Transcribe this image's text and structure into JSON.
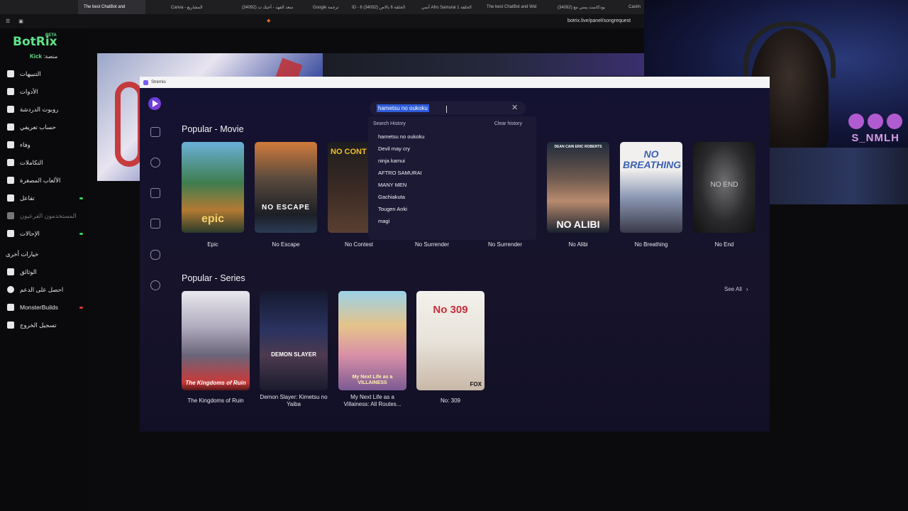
{
  "browser": {
    "tabs": [
      "The best ChatBot and",
      "Canva - المشاريع",
      "سعد الفهد - أحيك ت (34092)",
      "Google ترجمة",
      "ID - 6 الحلقة 6 بالاص (34092)",
      "أنمي Afro Samurai الحلقة 1",
      "The best ChatBot and Wid",
      "بودكاست يمني مع (34092)",
      "Castin"
    ],
    "url": "botrix.live/panel/songrequest"
  },
  "botrix": {
    "logo": "BotRix",
    "beta": "BETA",
    "platform_label": "منصة:",
    "platform_value": "Kick",
    "nav": [
      {
        "label": "التنبيهات",
        "icon": "alert-icon"
      },
      {
        "label": "الأدوات",
        "icon": "tools-icon"
      },
      {
        "label": "روبوت الدردشة",
        "icon": "bot-icon"
      },
      {
        "label": "حساب تعريفي",
        "icon": "profile-icon"
      },
      {
        "label": "وفاء",
        "icon": "trophy-icon"
      },
      {
        "label": "التكاملات",
        "icon": "integrations-icon"
      },
      {
        "label": "الألعاب المصغرة",
        "icon": "minigames-icon"
      },
      {
        "label": "تفاعل",
        "icon": "music-icon"
      },
      {
        "label": "المستخدمون الفرعيون",
        "icon": "subusers-icon"
      },
      {
        "label": "الإحالات",
        "icon": "referrals-icon"
      }
    ],
    "other_section": "خيارات أخرى",
    "other_nav": [
      {
        "label": "الوثائق",
        "icon": "docs-icon"
      },
      {
        "label": "احصل على الدعم",
        "icon": "support-icon"
      },
      {
        "label": "MonsterBuilds",
        "icon": "monster-icon"
      },
      {
        "label": "تسجيل الخروج",
        "icon": "logout-icon"
      }
    ]
  },
  "webcam": {
    "handle": "S_NMLH"
  },
  "stremio": {
    "window_title": "Stremio",
    "search": {
      "value": "hametsu no oukoku"
    },
    "history": {
      "header": "Search History",
      "clear": "Clear history",
      "items": [
        "hametsu no oukoku",
        "Devil may cry",
        "ninja kamui",
        "AFTRO SAMURAI",
        "MANY MEN",
        "Gachiakuta",
        "Tougen Anki",
        "magi"
      ]
    },
    "movies": {
      "title": "Popular - Movie",
      "items": [
        "Epic",
        "No Escape",
        "No Contest",
        "No Surrender",
        "No Surrender",
        "No Alibi",
        "No Breathing",
        "No End"
      ],
      "poster_text": {
        "epic": "epic",
        "noescape": "NO ESCAPE",
        "nocontest": "NO CONT",
        "noalibi": "NO ALIBI",
        "nobreathing": "NO BREATHING",
        "noend": "NO END",
        "noalibi_top": "DEAN CAIN  ERIC ROBERTS"
      }
    },
    "series": {
      "title": "Popular - Series",
      "see_all": "See All",
      "items": [
        "The Kingdoms of Ruin",
        "Demon Slayer: Kimetsu no Yaiba",
        "My Next Life as a Villainess: All Routes...",
        "No: 309"
      ],
      "poster_text": {
        "kingdoms": "The Kingdoms of Ruin",
        "demon": "DEMON SLAYER",
        "mynext": "My Next Life as a VILLAINESS",
        "no309": "No 309",
        "fox": "FOX"
      }
    }
  }
}
